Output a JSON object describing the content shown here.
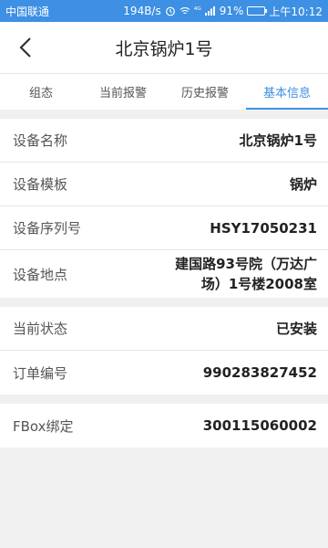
{
  "status_bar": {
    "carrier": "中国联通",
    "speed": "194B/s",
    "signal": "⁴ᴳ",
    "battery": "91%",
    "battery_level": 0.91,
    "time": "上午10:12"
  },
  "header": {
    "title": "北京锅炉1号"
  },
  "tabs": [
    {
      "label": "组态",
      "active": false
    },
    {
      "label": "当前报警",
      "active": false
    },
    {
      "label": "历史报警",
      "active": false
    },
    {
      "label": "基本信息",
      "active": true
    }
  ],
  "info_section_1": [
    {
      "label": "设备名称",
      "value": "北京锅炉1号"
    },
    {
      "label": "设备模板",
      "value": "锅炉"
    },
    {
      "label": "设备序列号",
      "value": "HSY17050231"
    },
    {
      "label": "设备地点",
      "value": "建国路93号院（万达广场）1号楼2008室"
    }
  ],
  "info_section_2": [
    {
      "label": "当前状态",
      "value": "已安装"
    },
    {
      "label": "订单编号",
      "value": "990283827452"
    }
  ],
  "info_section_3": [
    {
      "label": "FBox绑定",
      "value": "300115060002"
    }
  ],
  "colors": {
    "accent": "#3d90e3",
    "background": "#f0f0f0"
  }
}
